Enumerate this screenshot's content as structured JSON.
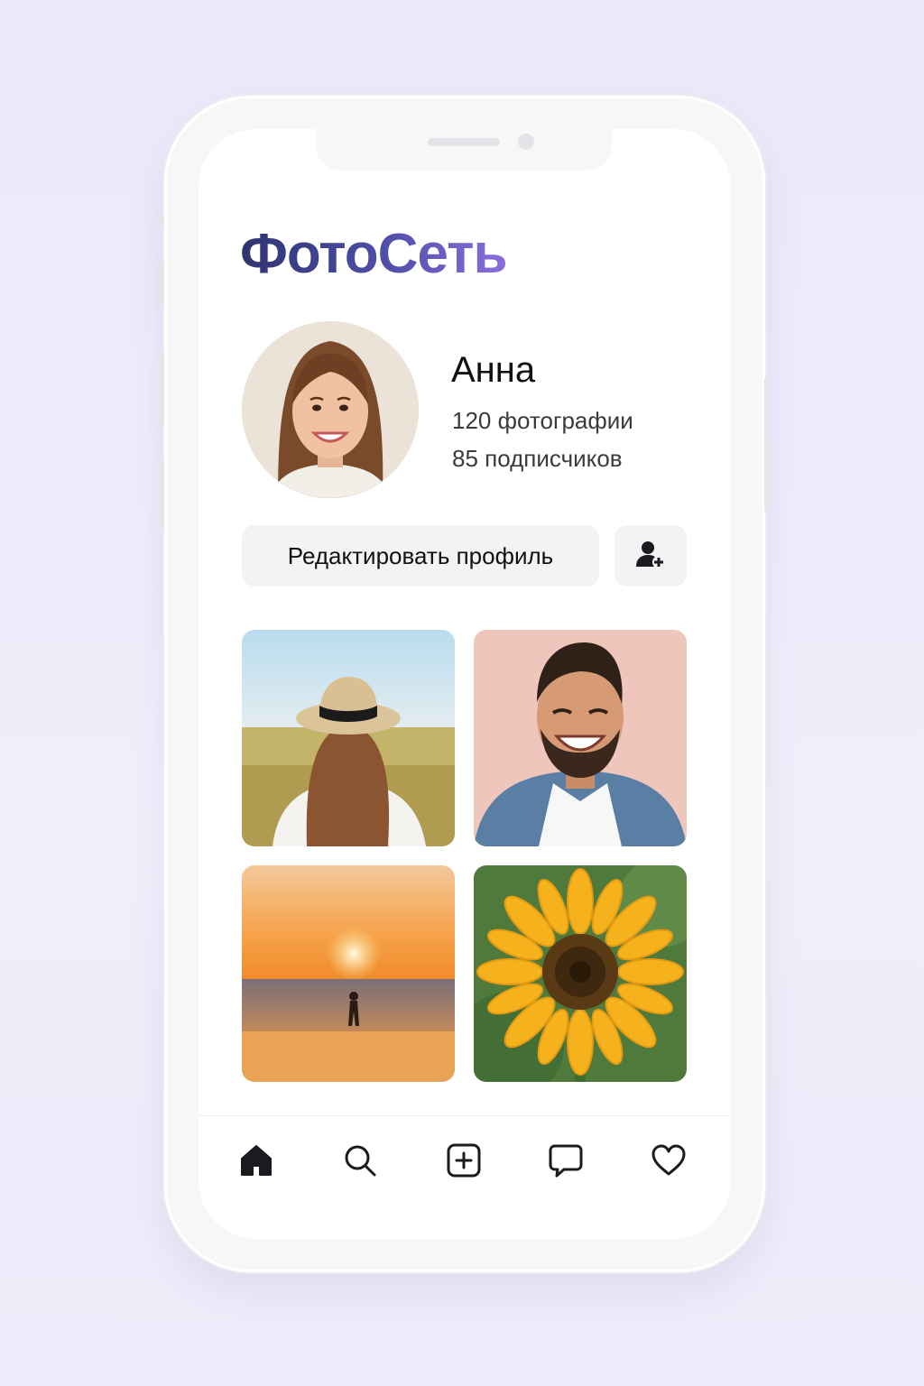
{
  "app": {
    "brand": "ФотоСеть"
  },
  "profile": {
    "name": "Анна",
    "photos": "120 фотографии",
    "followers": "85 подписчиков"
  },
  "actions": {
    "edit_label": "Редактировать профиль",
    "add_friend_icon": "add-user-icon"
  },
  "gallery": [
    {
      "name": "photo-girl-hat-field"
    },
    {
      "name": "photo-smiling-man"
    },
    {
      "name": "photo-sunset-beach"
    },
    {
      "name": "photo-sunflower"
    }
  ],
  "tabbar": [
    "home-icon",
    "search-icon",
    "add-post-icon",
    "messages-icon",
    "likes-icon"
  ],
  "colors": {
    "accent_start": "#2f3470",
    "accent_end": "#8b6fdc",
    "button_bg": "#f3f3f5"
  }
}
